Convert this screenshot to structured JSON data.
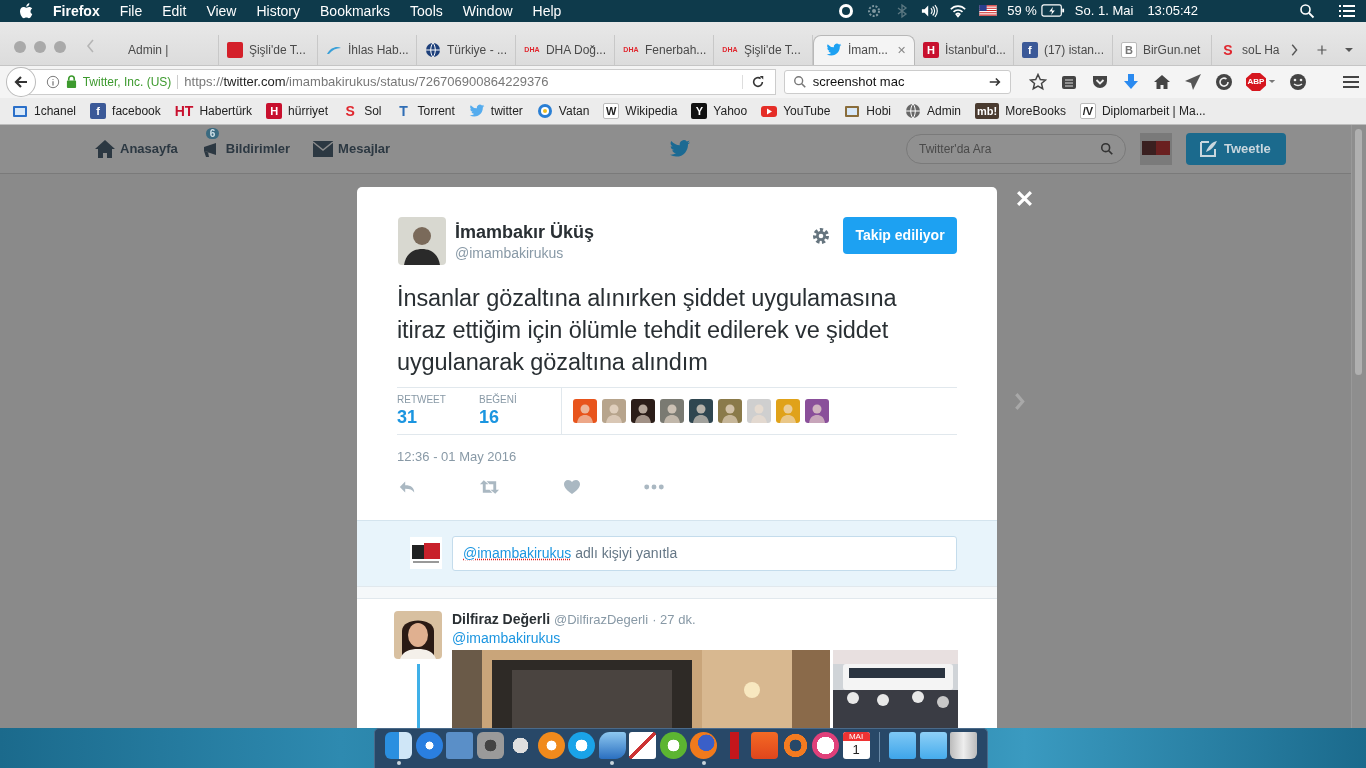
{
  "menu_bar": {
    "app": "Firefox",
    "menus": [
      "File",
      "Edit",
      "View",
      "History",
      "Bookmarks",
      "Tools",
      "Window",
      "Help"
    ],
    "battery": "59 %",
    "date": "So. 1. Mai",
    "time": "13:05:42"
  },
  "tabs": [
    {
      "label": "Admin |",
      "selected": false,
      "icon": {
        "kind": "none"
      }
    },
    {
      "label": "Şişli'de T...",
      "selected": false,
      "icon": {
        "kind": "tile",
        "color": "#d4202a"
      }
    },
    {
      "label": "İhlas Hab...",
      "selected": false,
      "icon": {
        "kind": "swoosh",
        "color": "#3aa0d8"
      }
    },
    {
      "label": "Türkiye - ...",
      "selected": false,
      "icon": {
        "kind": "globe",
        "color": "#1d3f7a"
      }
    },
    {
      "label": "DHA Doğ...",
      "selected": false,
      "icon": {
        "kind": "letter",
        "color": "#e0262e",
        "mark": "DHA"
      }
    },
    {
      "label": "Fenerbah...",
      "selected": false,
      "icon": {
        "kind": "letter",
        "color": "#e0262e",
        "mark": "DHA"
      }
    },
    {
      "label": "Şişli'de T...",
      "selected": false,
      "icon": {
        "kind": "letter",
        "color": "#e0262e",
        "mark": "DHA"
      }
    },
    {
      "label": "İmam...",
      "selected": true,
      "icon": {
        "kind": "bird",
        "color": "#1da1f2"
      },
      "close": "✕"
    },
    {
      "label": "İstanbul'd...",
      "selected": false,
      "icon": {
        "kind": "tile",
        "color": "#c8102e",
        "mark": "H"
      }
    },
    {
      "label": "(17) istan...",
      "selected": false,
      "icon": {
        "kind": "tile",
        "color": "#3b5998",
        "mark": "f"
      }
    },
    {
      "label": "BirGun.net",
      "selected": false,
      "icon": {
        "kind": "outline",
        "color": "#777777",
        "mark": "B"
      }
    },
    {
      "label": "soL Ha",
      "selected": false,
      "icon": {
        "kind": "letter",
        "color": "#e0262e",
        "mark": "S"
      }
    }
  ],
  "nav": {
    "identity": "Twitter, Inc. (US)",
    "url": {
      "scheme": "https://",
      "host": "twitter.com",
      "path": "/imambakirukus/status/726706900864229376"
    },
    "search": {
      "value": "screenshot mac"
    },
    "adblock": "ABP"
  },
  "bookmarks": [
    {
      "label": "1chanel",
      "icon": {
        "kind": "film",
        "color": "#2a6fc9"
      }
    },
    {
      "label": "facebook",
      "icon": {
        "kind": "tile",
        "color": "#3b5998",
        "mark": "f"
      }
    },
    {
      "label": "Habertürk",
      "icon": {
        "kind": "letter",
        "color": "#c8102e",
        "mark": "HT"
      }
    },
    {
      "label": "hürriyet",
      "icon": {
        "kind": "tile",
        "color": "#c8102e",
        "mark": "H"
      }
    },
    {
      "label": "Sol",
      "icon": {
        "kind": "letter",
        "color": "#e0262e",
        "mark": "S"
      }
    },
    {
      "label": "Torrent",
      "icon": {
        "kind": "letter",
        "color": "#2f6db5",
        "mark": "T"
      }
    },
    {
      "label": "twitter",
      "icon": {
        "kind": "bird",
        "color": "#55acee"
      }
    },
    {
      "label": "Vatan",
      "icon": {
        "kind": "target",
        "color": "#2a7fd4"
      }
    },
    {
      "label": "Wikipedia",
      "icon": {
        "kind": "outline",
        "color": "#222222",
        "mark": "W"
      }
    },
    {
      "label": "Yahoo",
      "icon": {
        "kind": "tile",
        "color": "#111111",
        "mark": "Y"
      }
    },
    {
      "label": "YouTube",
      "icon": {
        "kind": "play",
        "color": "#e52d27"
      }
    },
    {
      "label": "Hobi",
      "icon": {
        "kind": "film",
        "color": "#8a6d3b"
      }
    },
    {
      "label": "Admin",
      "icon": {
        "kind": "globe",
        "color": "#666666"
      }
    },
    {
      "label": "MoreBooks",
      "icon": {
        "kind": "tile",
        "color": "#4a3b30",
        "mark": "mb!"
      }
    },
    {
      "label": "Diplomarbeit | Ma...",
      "icon": {
        "kind": "outline",
        "color": "#222222",
        "mark": "/V"
      }
    }
  ],
  "twitter_nav": {
    "items": [
      {
        "label": "Anasayfa",
        "kind": "home"
      },
      {
        "label": "Bildirimler",
        "kind": "bell",
        "badge": "6"
      },
      {
        "label": "Mesajlar",
        "kind": "mail"
      }
    ],
    "search": {
      "placeholder": "Twitter'da Ara"
    },
    "tweet_button": "Tweetle"
  },
  "tweet": {
    "author": "İmambakır Üküş",
    "handle": "@imambakirukus",
    "follow_button": "Takip ediliyor",
    "text": "İnsanlar gözaltına alınırken şiddet uygulamasına itiraz ettiğim için ölümle tehdit edilerek ve şiddet uygulanarak gözaltına alındım",
    "stats": [
      {
        "label": "RETWEET",
        "value": "31"
      },
      {
        "label": "BEĞENİ",
        "value": "16"
      }
    ],
    "likers": [
      {
        "color": "#e8541c"
      },
      {
        "color": "#b7a48c"
      },
      {
        "color": "#2b1d18"
      },
      {
        "color": "#7a7a72"
      },
      {
        "color": "#2f4650"
      },
      {
        "color": "#8a7a4a"
      },
      {
        "color": "#cfcfcf"
      },
      {
        "color": "#e0a21a"
      },
      {
        "color": "#8a4f9a"
      }
    ],
    "date": "12:36 - 01 May 2016"
  },
  "reply": {
    "mention": "@imambakirukus",
    "text": "adlı kişiyi yanıtla"
  },
  "next_tweet": {
    "author": "Dilfiraz Değerli",
    "handle": "@DilfirazDegerli",
    "time": "· 27 dk.",
    "mention": "@imambakirukus"
  },
  "dock": [
    {
      "kind": "finder",
      "running": true
    },
    {
      "kind": "safari",
      "running": false
    },
    {
      "kind": "stamp",
      "running": false
    },
    {
      "kind": "gear",
      "running": false
    },
    {
      "kind": "robot",
      "running": false
    },
    {
      "kind": "books",
      "running": false
    },
    {
      "kind": "skype",
      "running": false
    },
    {
      "kind": "wave",
      "running": true
    },
    {
      "kind": "cards",
      "running": false
    },
    {
      "kind": "torrent",
      "running": false
    },
    {
      "kind": "firefox",
      "running": true
    },
    {
      "kind": "extinguisher",
      "running": false
    },
    {
      "kind": "kies",
      "running": false
    },
    {
      "kind": "origin",
      "running": false
    },
    {
      "kind": "music",
      "running": false
    },
    {
      "kind": "calendar",
      "running": false,
      "month": "MAI",
      "day": "1"
    },
    {
      "kind": "separator"
    },
    {
      "kind": "apps-folder",
      "running": false
    },
    {
      "kind": "folder",
      "running": false
    },
    {
      "kind": "trash",
      "running": false
    }
  ]
}
